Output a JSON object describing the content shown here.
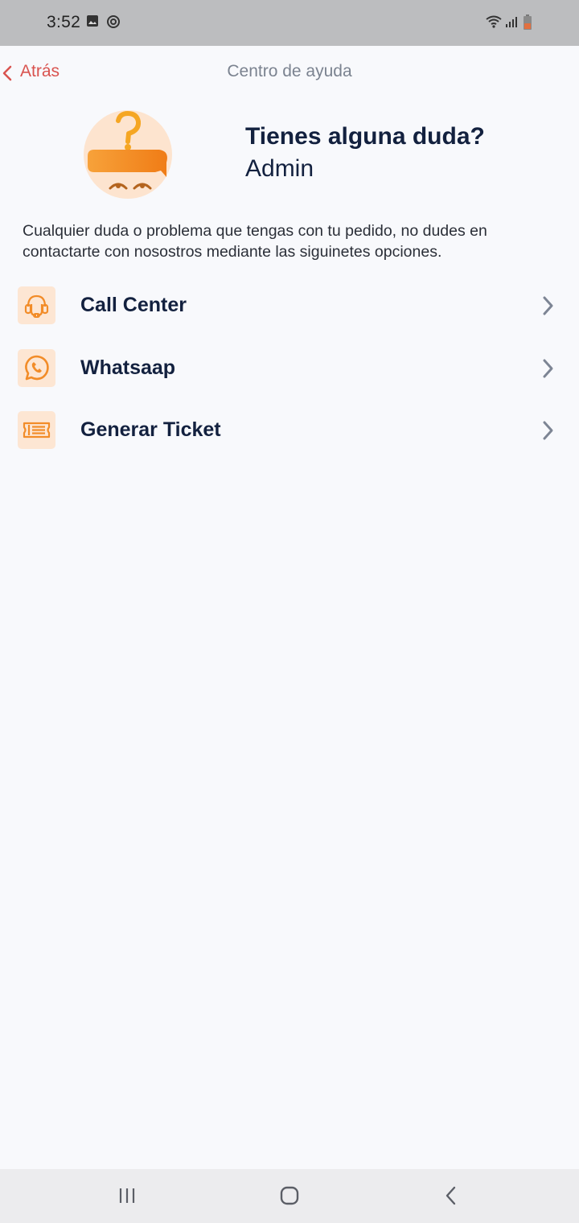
{
  "status_bar": {
    "time": "3:52",
    "left_icons": [
      "image-icon",
      "sync-icon"
    ],
    "right_icons": [
      "wifi-icon",
      "signal-icon",
      "battery-icon"
    ]
  },
  "header": {
    "back_label": "Atrás",
    "title": "Centro de ayuda"
  },
  "hero": {
    "heading": "Tienes alguna duda?",
    "user_name": "Admin",
    "illustration": "question-face-illustration"
  },
  "description": "Cualquier duda o problema que tengas con tu pedido, no dudes en contactarte con nosostros mediante las siguinetes opciones.",
  "options": [
    {
      "label": "Call Center",
      "icon": "headset-icon"
    },
    {
      "label": "Whatsaap",
      "icon": "whatsapp-icon"
    },
    {
      "label": "Generar Ticket",
      "icon": "ticket-icon"
    }
  ],
  "colors": {
    "accent": "#f28c28",
    "back_link": "#d9534f",
    "text_primary": "#13213f",
    "icon_bg": "#fde6d3"
  },
  "nav_bar": [
    "recent-apps-icon",
    "home-icon",
    "back-icon"
  ]
}
